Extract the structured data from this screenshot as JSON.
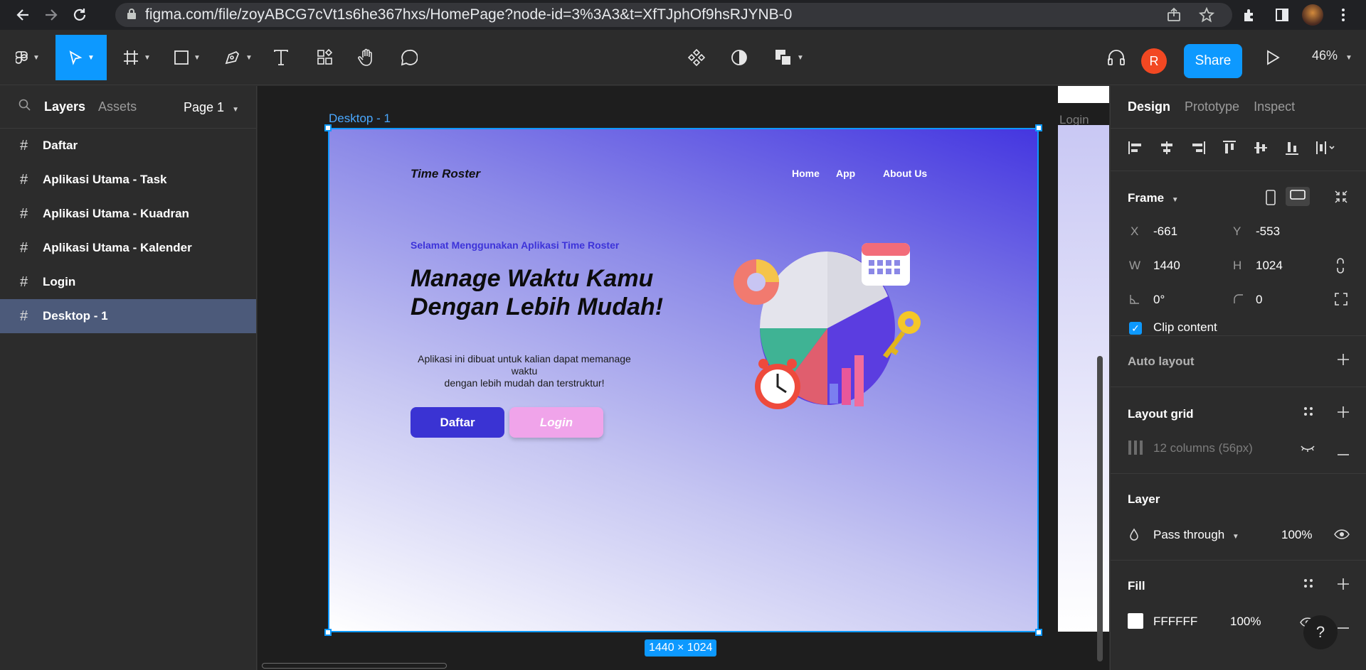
{
  "browser": {
    "url": "figma.com/file/zoyABCG7cVt1s6he367hxs/HomePage?node-id=3%3A3&t=XfTJphOf9hsRJYNB-0"
  },
  "toolbar": {
    "share_label": "Share",
    "avatar_initial": "R",
    "zoom": "46%"
  },
  "left_panel": {
    "tabs": [
      "Layers",
      "Assets"
    ],
    "page_selector": "Page 1",
    "layers": [
      {
        "name": "Daftar"
      },
      {
        "name": "Aplikasi Utama - Task"
      },
      {
        "name": "Aplikasi Utama - Kuadran"
      },
      {
        "name": "Aplikasi Utama - Kalender"
      },
      {
        "name": "Login"
      },
      {
        "name": "Desktop - 1"
      }
    ]
  },
  "canvas": {
    "frame_label": "Desktop - 1",
    "side_frame_label": "Login",
    "size_badge": "1440 × 1024"
  },
  "design": {
    "brand": "Time Roster",
    "nav": [
      "Home",
      "App",
      "About Us"
    ],
    "welcome": "Selamat Menggunakan Aplikasi Time Roster",
    "headline_line1": "Manage Waktu Kamu",
    "headline_line2": "Dengan Lebih Mudah!",
    "desc_line1": "Aplikasi ini dibuat untuk kalian dapat memanage",
    "desc_line2": "waktu",
    "desc_line3": "dengan lebih mudah dan terstruktur!",
    "btn_daftar": "Daftar",
    "btn_login": "Login"
  },
  "right_panel": {
    "tabs": [
      "Design",
      "Prototype",
      "Inspect"
    ],
    "frame_title": "Frame",
    "x_label": "X",
    "x_value": "-661",
    "y_label": "Y",
    "y_value": "-553",
    "w_label": "W",
    "w_value": "1440",
    "h_label": "H",
    "h_value": "1024",
    "rotation": "0°",
    "radius": "0",
    "clip_content": "Clip content",
    "auto_layout": "Auto layout",
    "layout_grid": "Layout grid",
    "grid_desc": "12 columns (56px)",
    "layer_title": "Layer",
    "blend_mode": "Pass through",
    "opacity": "100%",
    "fill_title": "Fill",
    "fill_hex": "FFFFFF",
    "fill_opacity": "100%"
  },
  "colors": {
    "accent": "#0d99ff",
    "daftar_button": "#3a33d3",
    "login_button": "#f0a4ea",
    "avatar": "#f24822"
  }
}
